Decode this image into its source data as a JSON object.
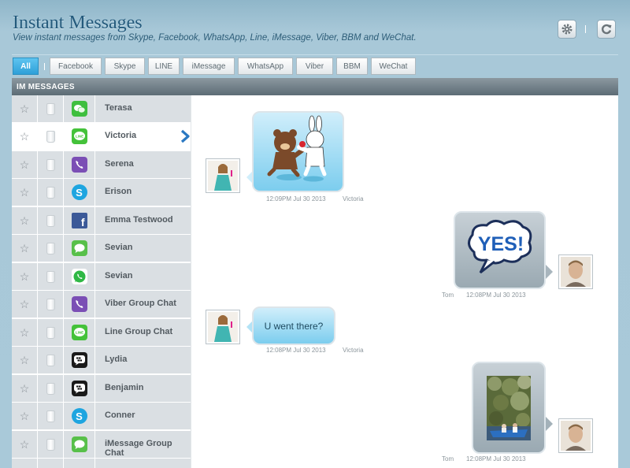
{
  "header": {
    "title": "Instant Messages",
    "subtitle": "View instant messages from Skype, Facebook, WhatsApp, Line, iMessage, Viber, BBM and WeChat."
  },
  "toolbar": {
    "settings_icon": "gear-icon",
    "refresh_icon": "refresh-icon"
  },
  "filters": [
    "All",
    "Facebook",
    "Skype",
    "LINE",
    "iMessage",
    "WhatsApp",
    "Viber",
    "BBM",
    "WeChat"
  ],
  "active_filter": "All",
  "section_title": "IM MESSAGES",
  "contacts": [
    {
      "name": "Terasa",
      "app": "WeChat",
      "color": "#3fbf3f"
    },
    {
      "name": "Victoria",
      "app": "LINE",
      "color": "#44c23a"
    },
    {
      "name": "Serena",
      "app": "Viber",
      "color": "#7b4fb5"
    },
    {
      "name": "Erison",
      "app": "Skype",
      "color": "#1ea5e0"
    },
    {
      "name": "Emma Testwood",
      "app": "Facebook",
      "color": "#3b5998"
    },
    {
      "name": "Sevian",
      "app": "iMessage",
      "color": "#58c04a"
    },
    {
      "name": "Sevian",
      "app": "WhatsApp",
      "color": "#2fb845"
    },
    {
      "name": "Viber Group Chat",
      "app": "Viber",
      "color": "#7b4fb5"
    },
    {
      "name": "Line Group Chat",
      "app": "LINE",
      "color": "#44c23a"
    },
    {
      "name": "Lydia",
      "app": "BBM",
      "color": "#1a1a1a"
    },
    {
      "name": "Benjamin",
      "app": "BBM",
      "color": "#1a1a1a"
    },
    {
      "name": "Conner",
      "app": "Skype",
      "color": "#1ea5e0"
    },
    {
      "name": "iMessage Group Chat",
      "app": "iMessage",
      "color": "#58c04a"
    }
  ],
  "selected_contact": "Victoria",
  "messages": [
    {
      "direction": "in",
      "kind": "sticker",
      "time": "12:09PM Jul 30 2013",
      "sender": "Victoria"
    },
    {
      "direction": "out",
      "kind": "sticker",
      "sticker_text": "YES!",
      "time": "12:08PM Jul 30 2013",
      "sender": "Tom"
    },
    {
      "direction": "in",
      "kind": "text",
      "text": "U went there?",
      "time": "12:08PM Jul 30 2013",
      "sender": "Victoria"
    },
    {
      "direction": "out",
      "kind": "photo",
      "time": "12:08PM Jul 30 2013",
      "sender": "Tom"
    }
  ]
}
